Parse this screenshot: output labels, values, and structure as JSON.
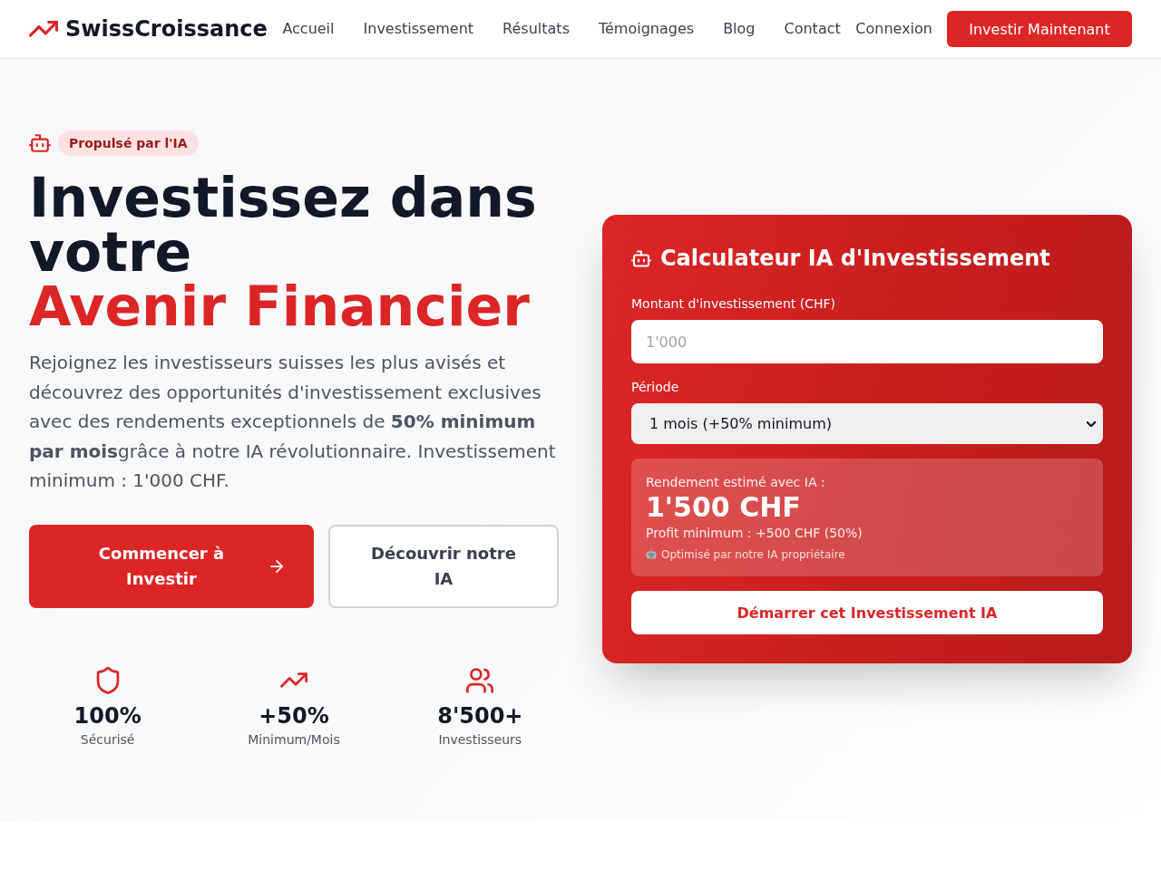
{
  "header": {
    "brand": "SwissCroissance",
    "nav": [
      "Accueil",
      "Investissement",
      "Résultats",
      "Témoignages",
      "Blog",
      "Contact"
    ],
    "login": "Connexion",
    "cta": "Investir Maintenant"
  },
  "hero": {
    "badge": "Propulsé par l'IA",
    "title": "Investissez dans votre",
    "title_highlight": "Avenir Financier",
    "intro": "Rejoignez les investisseurs suisses les plus avisés et découvrez des opportunités d'investissement exclusives avec des rendements exceptionnels de **50% minimum par mois**grâce à notre IA révolutionnaire. Investissement minimum : 1'000 CHF.",
    "buttons": [
      {
        "label": "Commencer à Investir",
        "kind": "primary"
      },
      {
        "label": "Découvrir notre IA",
        "kind": "secondary"
      }
    ],
    "stats": [
      {
        "value": "100%",
        "label": "Sécurisé"
      },
      {
        "value": "+50%",
        "label": "Minimum/Mois"
      },
      {
        "value": "8'500+",
        "label": "Investisseurs"
      }
    ]
  },
  "calculator": {
    "title": "Calculateur IA d'Investissement",
    "amount": {
      "label": "Montant d'investissement (CHF)",
      "placeholder": "1'000"
    },
    "period": {
      "label": "Période",
      "value": "1 mois (+50% minimum)"
    },
    "result": {
      "label": "Rendement estimé avec IA :",
      "amount": "1'500 CHF",
      "profit": "Profit minimum : +500 CHF (50%)",
      "note": "Optimisé par notre IA propriétaire"
    },
    "button": "Démarrer cet Investissement IA"
  }
}
